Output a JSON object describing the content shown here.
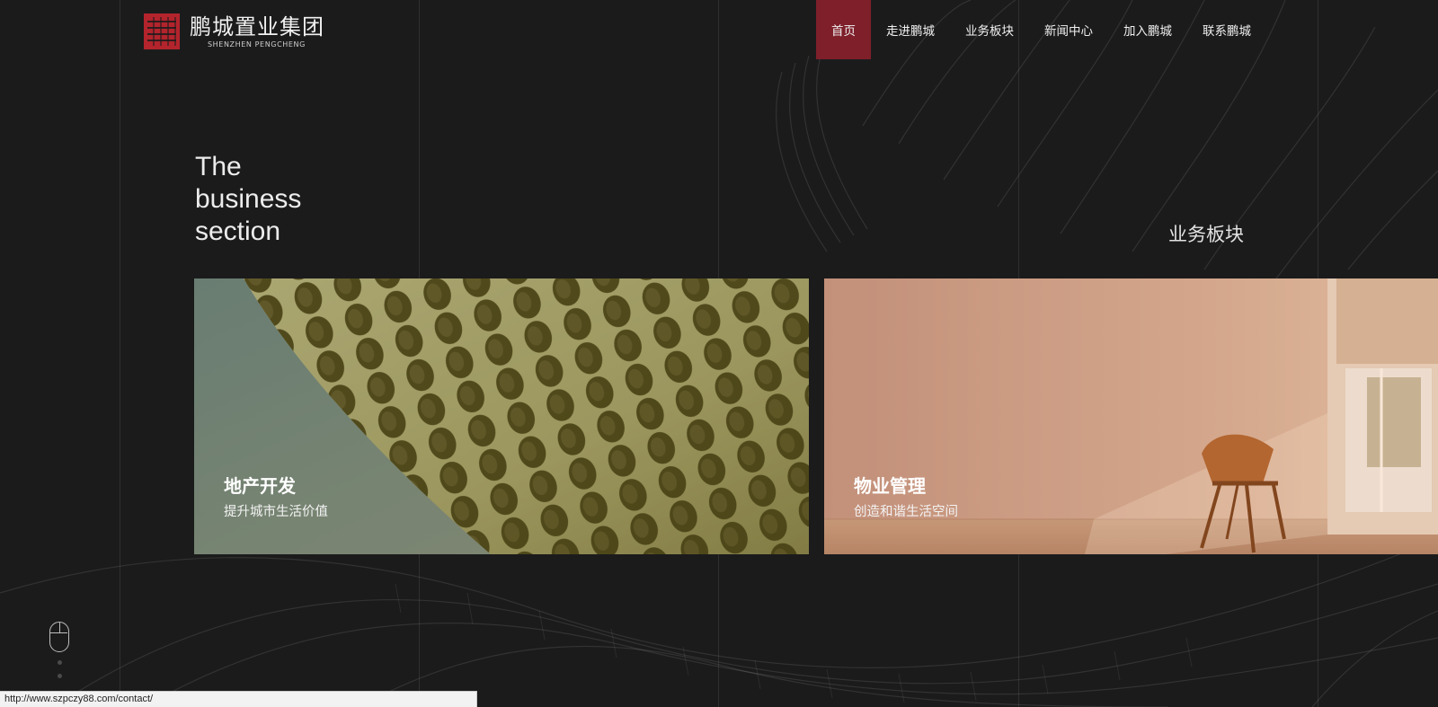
{
  "brand": {
    "name_cn": "鹏城置业集团",
    "name_en": "SHENZHEN PENGCHENG",
    "seal_color": "#b3242c"
  },
  "nav": {
    "items": [
      {
        "label": "首页",
        "active": true
      },
      {
        "label": "走进鹏城",
        "active": false
      },
      {
        "label": "业务板块",
        "active": false
      },
      {
        "label": "新闻中心",
        "active": false
      },
      {
        "label": "加入鹏城",
        "active": false
      },
      {
        "label": "联系鹏城",
        "active": false
      }
    ],
    "active_color": "#7e1f2a"
  },
  "section": {
    "title_en_lines": [
      "The",
      "business",
      "section"
    ],
    "title_cn": "业务板块"
  },
  "cards": [
    {
      "title": "地产开发",
      "subtitle": "提升城市生活价值",
      "tint": "#8e8a55"
    },
    {
      "title": "物业管理",
      "subtitle": "创造和谐生活空间",
      "tint": "#c89a7e"
    }
  ],
  "scroll_hint": {
    "icon": "mouse-icon"
  },
  "status_bar": {
    "url": "http://www.szpczy88.com/contact/"
  }
}
